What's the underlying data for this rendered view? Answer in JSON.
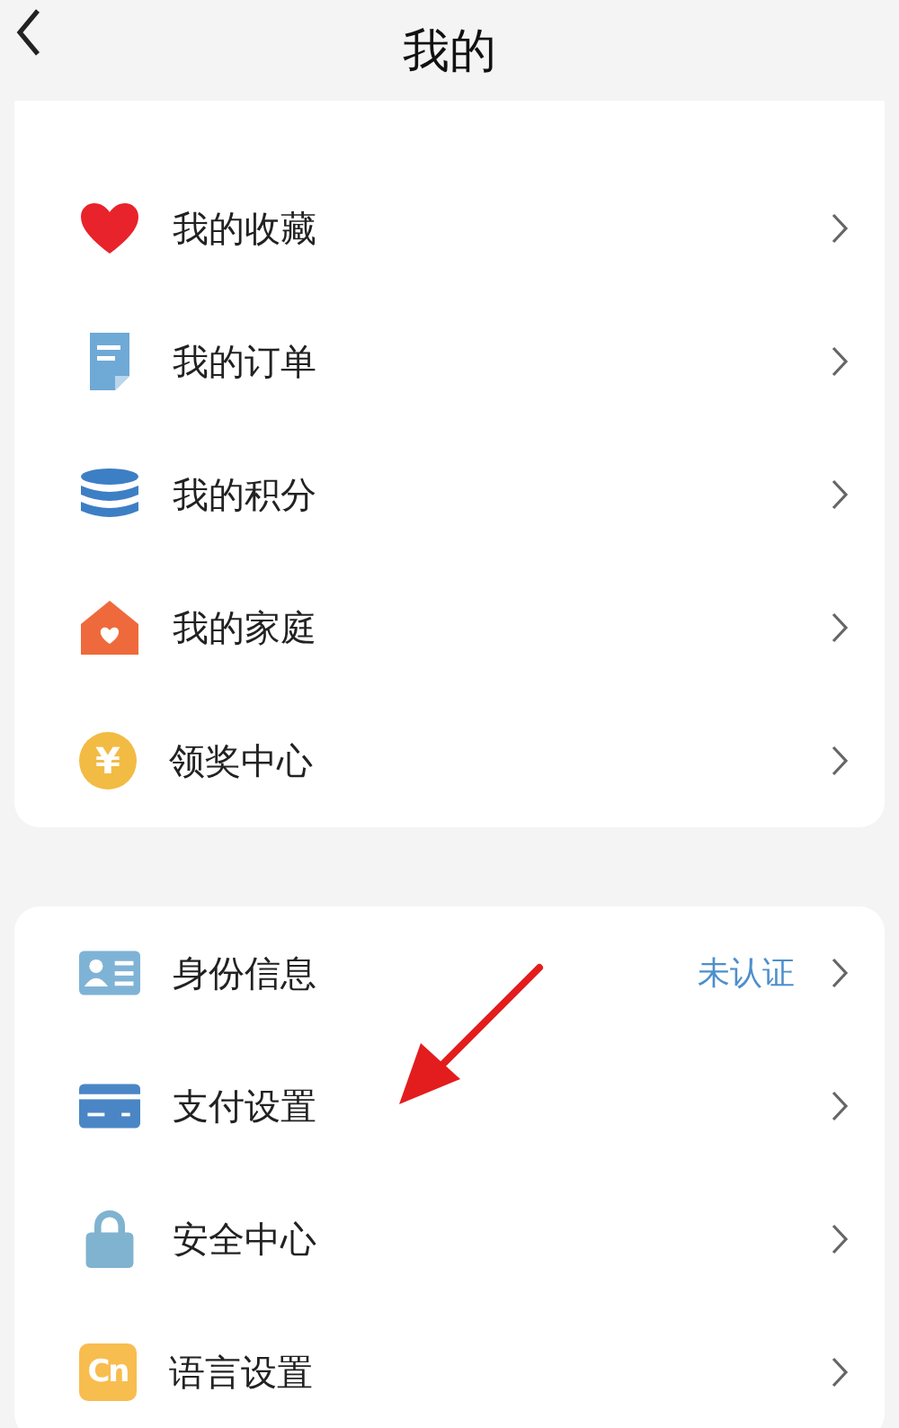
{
  "header": {
    "title": "我的"
  },
  "groups": [
    {
      "items": [
        {
          "kind": "heart",
          "label": "我的收藏"
        },
        {
          "kind": "document",
          "label": "我的订单"
        },
        {
          "kind": "coins",
          "label": "我的积分"
        },
        {
          "kind": "house",
          "label": "我的家庭"
        },
        {
          "kind": "yen",
          "label": "领奖中心",
          "icon_text": "¥"
        }
      ]
    },
    {
      "items": [
        {
          "kind": "idcard",
          "label": "身份信息",
          "status": "未认证"
        },
        {
          "kind": "card",
          "label": "支付设置"
        },
        {
          "kind": "lock",
          "label": "安全中心"
        },
        {
          "kind": "lang",
          "label": "语言设置",
          "icon_text": "Cn"
        }
      ]
    }
  ]
}
